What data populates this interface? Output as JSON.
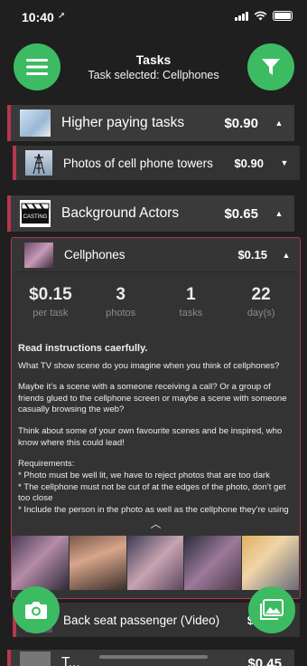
{
  "status": {
    "time": "10:40"
  },
  "header": {
    "title": "Tasks",
    "subtitle": "Task selected: Cellphones"
  },
  "rows": [
    {
      "name": "Higher paying tasks",
      "price": "$0.90",
      "chevron": "▲"
    },
    {
      "name": "Photos of cell phone towers",
      "price": "$0.90",
      "chevron": "▼"
    },
    {
      "name": "Background Actors",
      "price": "$0.65",
      "chevron": "▲"
    }
  ],
  "selected_task": {
    "name": "Cellphones",
    "price": "$0.15",
    "chevron": "▲",
    "stats": [
      {
        "value": "$0.15",
        "label": "per task"
      },
      {
        "value": "3",
        "label": "photos"
      },
      {
        "value": "1",
        "label": "tasks"
      },
      {
        "value": "22",
        "label": "day(s)"
      }
    ],
    "instructions_heading": "Read instructions caerfully.",
    "paragraphs": [
      "What TV show scene do you imagine when you think of cellphones?",
      "Maybe it’s a scene with a someone receiving a call? Or a group of friends glued to the cellphone screen or maybe a scene with someone casually browsing the web?",
      "Think about some of your own favourite scenes and be inspired, who know where this could lead!",
      "Requirements:\n* Photo must be well lit, we have to reject photos that are too dark\n* The cellphone must not be cut of at the edges of the photo, don’t get too close\n* Include the person in the photo as well as the cellphone they’re using"
    ]
  },
  "bottom_row": {
    "name": "Back seat passenger (Video)",
    "price": "$0.",
    "chevron": "▼"
  },
  "last_row": {
    "name": "T...",
    "price": "$0.45"
  },
  "colors": {
    "accent_green": "#3dbb63",
    "accent_red": "#b7374c",
    "row_bg": "#3a3a3a",
    "bg": "#1f1f1f"
  }
}
